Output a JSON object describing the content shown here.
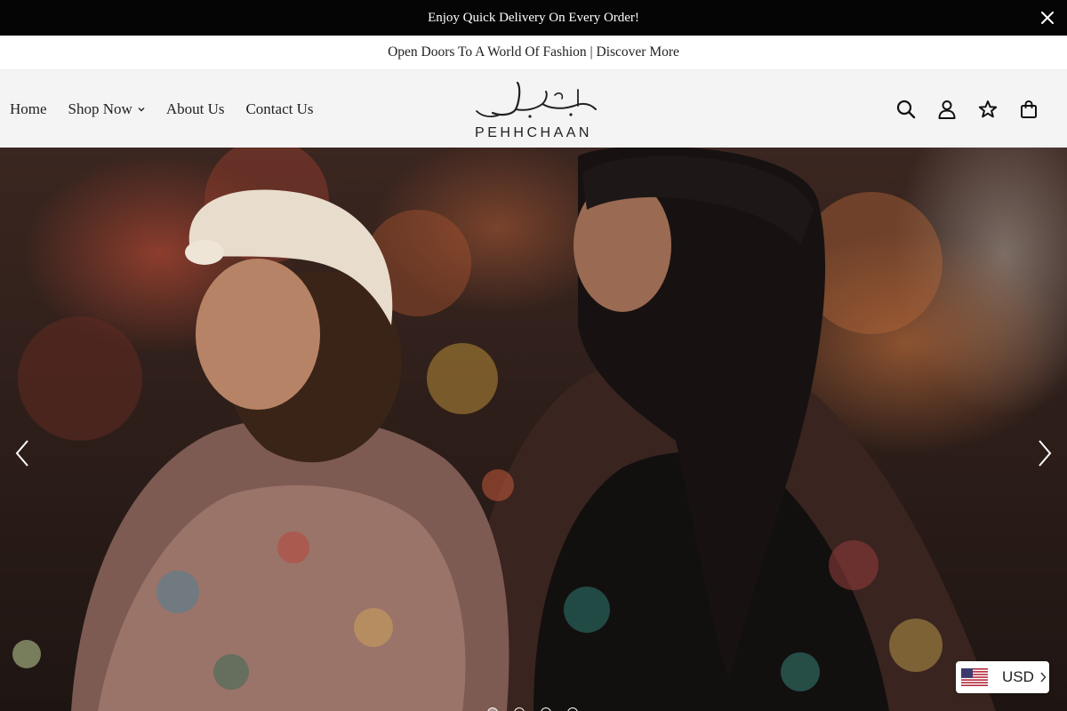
{
  "announcement": {
    "text": "Enjoy Quick Delivery On Every Order!",
    "close_icon": "close-icon"
  },
  "subbar": {
    "text": "Open Doors To A World Of Fashion | Discover More"
  },
  "nav": {
    "items": [
      {
        "label": "Home"
      },
      {
        "label": "Shop Now",
        "has_dropdown": true
      },
      {
        "label": "About Us"
      },
      {
        "label": "Contact Us"
      }
    ]
  },
  "logo": {
    "wordmark": "PEHHCHAAN"
  },
  "header_icons": [
    "search-icon",
    "account-icon",
    "wishlist-star-icon",
    "cart-bag-icon"
  ],
  "hero": {
    "slides": 4,
    "active_slide": 1,
    "prev_icon": "chevron-left-icon",
    "next_icon": "chevron-right-icon"
  },
  "currency": {
    "code": "USD",
    "flag": "us-flag-icon"
  },
  "colors": {
    "announcement_bg": "#050505",
    "header_bg": "#f4f4f4",
    "text": "#222222"
  }
}
